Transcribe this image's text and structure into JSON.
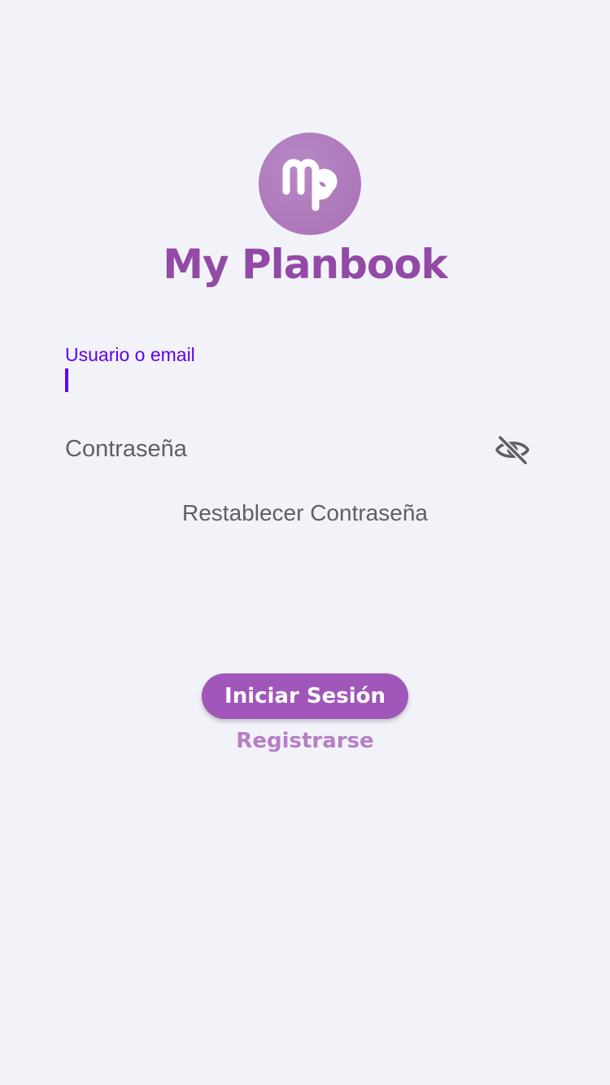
{
  "logo": {
    "monogram": "Mp",
    "app_name": "My Planbook",
    "icon": "mp-monogram-logo"
  },
  "form": {
    "username": {
      "label": "Usuario o email",
      "value": ""
    },
    "password": {
      "label": "Contraseña",
      "value": "",
      "toggle_icon": "eye-off-icon"
    },
    "reset_password_label": "Restablecer Contraseña"
  },
  "actions": {
    "login_label": "Iniciar Sesión",
    "register_label": "Registrarse"
  },
  "colors": {
    "background": "#f1f3f8",
    "brand_purple": "#9349a6",
    "button_purple": "#a057b9",
    "link_purple": "#b77fc6",
    "focus_accent": "#6200ee",
    "text_gray": "#5f5f66"
  }
}
